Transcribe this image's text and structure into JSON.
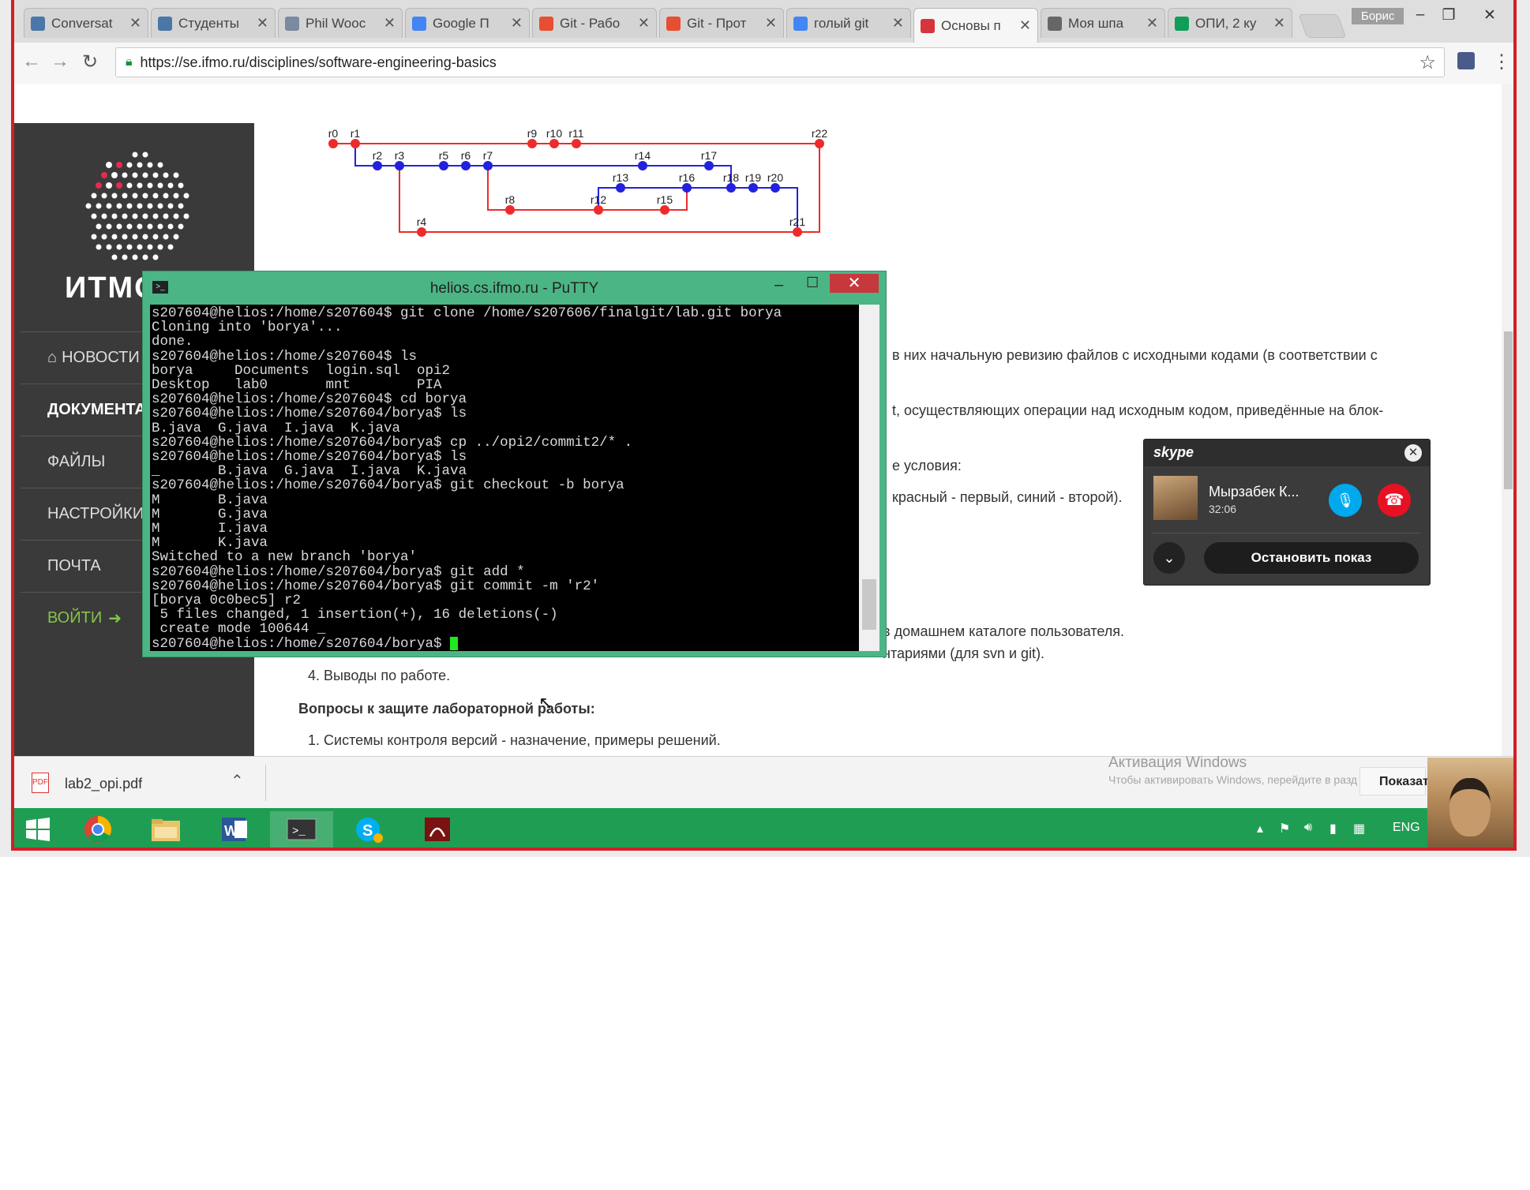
{
  "tabs": [
    {
      "label": "Conversat",
      "icon": "chat-icon",
      "color": "#4a76a8"
    },
    {
      "label": "Студенты",
      "icon": "vk-icon",
      "color": "#4a76a8"
    },
    {
      "label": "Phil Wooc",
      "icon": "pause-icon",
      "color": "#7a8aa0"
    },
    {
      "label": "Google П",
      "icon": "google-drive-icon",
      "color": "#4285f4"
    },
    {
      "label": "Git - Рабо",
      "icon": "git-icon",
      "color": "#e84e31"
    },
    {
      "label": "Git - Прот",
      "icon": "git-icon",
      "color": "#e84e31"
    },
    {
      "label": "голый git",
      "icon": "google-icon",
      "color": "#4285f4"
    },
    {
      "label": "Основы п",
      "icon": "site-icon",
      "color": "#d8343c"
    },
    {
      "label": "Моя шпа",
      "icon": "grid-icon",
      "color": "#666666"
    },
    {
      "label": "ОПИ, 2 ку",
      "icon": "sheets-icon",
      "color": "#0f9d58"
    }
  ],
  "user_label": "Борис",
  "url": "https://se.ifmo.ru/disciplines/software-engineering-basics",
  "sidebar": {
    "logo_text": "ИТМО",
    "items": [
      {
        "label": "НОВОСТИ",
        "icon": "home-icon"
      },
      {
        "label": "ДОКУМЕНТА"
      },
      {
        "label": "ФАЙЛЫ"
      },
      {
        "label": "НАСТРОЙКИ"
      },
      {
        "label": "ПОЧТА"
      },
      {
        "label": "ВОЙТИ",
        "icon": "sign-in-icon"
      }
    ]
  },
  "graph": {
    "nodes": [
      {
        "label": "r0",
        "color": "red"
      },
      {
        "label": "r1",
        "color": "red"
      },
      {
        "label": "r9",
        "color": "red"
      },
      {
        "label": "r10",
        "color": "red"
      },
      {
        "label": "r11",
        "color": "red"
      },
      {
        "label": "r22",
        "color": "red"
      },
      {
        "label": "r2",
        "color": "blue"
      },
      {
        "label": "r3",
        "color": "blue"
      },
      {
        "label": "r5",
        "color": "blue"
      },
      {
        "label": "r6",
        "color": "blue"
      },
      {
        "label": "r7",
        "color": "blue"
      },
      {
        "label": "r14",
        "color": "blue"
      },
      {
        "label": "r17",
        "color": "blue"
      },
      {
        "label": "r13",
        "color": "blue"
      },
      {
        "label": "r16",
        "color": "blue"
      },
      {
        "label": "r18",
        "color": "blue"
      },
      {
        "label": "r19",
        "color": "blue"
      },
      {
        "label": "r20",
        "color": "blue"
      },
      {
        "label": "r8",
        "color": "red"
      },
      {
        "label": "r12",
        "color": "red"
      },
      {
        "label": "r15",
        "color": "red"
      },
      {
        "label": "r4",
        "color": "red"
      },
      {
        "label": "r21",
        "color": "red"
      }
    ]
  },
  "content": {
    "p1": "в них начальную ревизию файлов с исходными кодами (в соответствии с",
    "p2": "t, осуществляющих операции над исходным кодом, приведённые на блок-",
    "p3": "е условия:",
    "p4": "красный - первый, синий - второй).",
    "p5": "в домашнем каталоге пользователя.",
    "p6": "нтариями (для svn и git).",
    "item4": "4. Выводы по работе.",
    "questions_heading": "Вопросы к защите лабораторной работы:",
    "q1": "1. Системы контроля версий - назначение, примеры решений."
  },
  "putty": {
    "title": "helios.cs.ifmo.ru - PuTTY",
    "lines": [
      "s207604@helios:/home/s207604$ git clone /home/s207606/finalgit/lab.git borya",
      "Cloning into 'borya'...",
      "done.",
      "s207604@helios:/home/s207604$ ls",
      "borya     Documents  login.sql  opi2",
      "Desktop   lab0       mnt        PIA",
      "s207604@helios:/home/s207604$ cd borya",
      "s207604@helios:/home/s207604/borya$ ls",
      "B.java  G.java  I.java  K.java",
      "s207604@helios:/home/s207604/borya$ cp ../opi2/commit2/* .",
      "s207604@helios:/home/s207604/borya$ ls",
      "_       B.java  G.java  I.java  K.java",
      "s207604@helios:/home/s207604/borya$ git checkout -b borya",
      "M       B.java",
      "M       G.java",
      "M       I.java",
      "M       K.java",
      "Switched to a new branch 'borya'",
      "s207604@helios:/home/s207604/borya$ git add *",
      "s207604@helios:/home/s207604/borya$ git commit -m 'r2'",
      "[borya 0c0bec5] r2",
      " 5 files changed, 1 insertion(+), 16 deletions(-)",
      " create mode 100644 _",
      "s207604@helios:/home/s207604/borya$ "
    ]
  },
  "skype": {
    "brand": "skype",
    "caller": "Мырзабек К...",
    "duration": "32:06",
    "stop_share": "Остановить показ"
  },
  "download": {
    "filename": "lab2_opi.pdf"
  },
  "activation": {
    "title": "Активация Windows",
    "text": "Чтобы активировать Windows, перейдите в разд",
    "button": "Показат"
  },
  "taskbar": {
    "lang": "ENG"
  }
}
